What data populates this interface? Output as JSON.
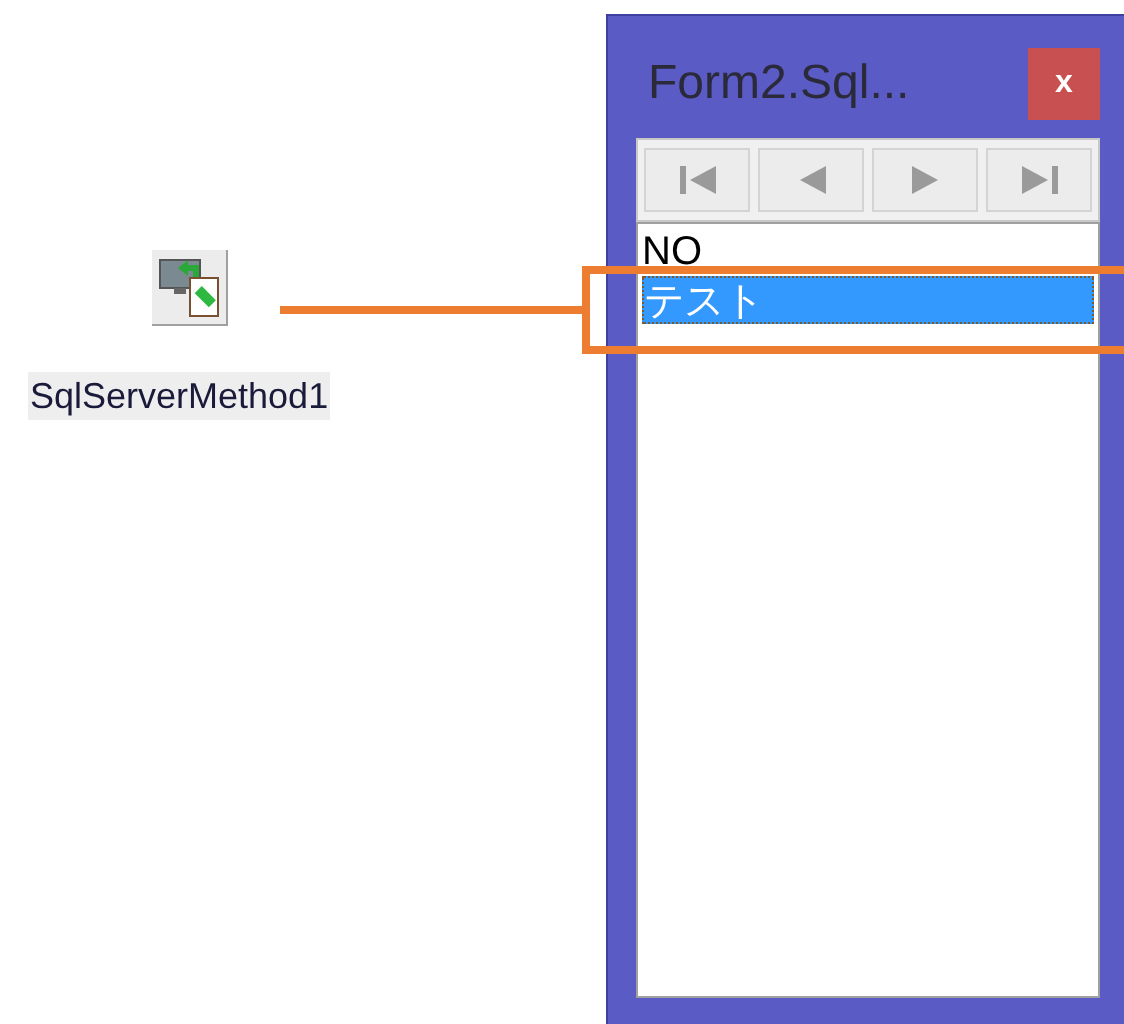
{
  "component": {
    "label": "SqlServerMethod1"
  },
  "window": {
    "title": "Form2.Sql...",
    "close": "x"
  },
  "navigator": [
    {
      "kind": "first"
    },
    {
      "kind": "prev"
    },
    {
      "kind": "next"
    },
    {
      "kind": "last"
    }
  ],
  "list": [
    {
      "text": "NO",
      "selected": false
    },
    {
      "text": "テスト",
      "selected": true
    }
  ]
}
